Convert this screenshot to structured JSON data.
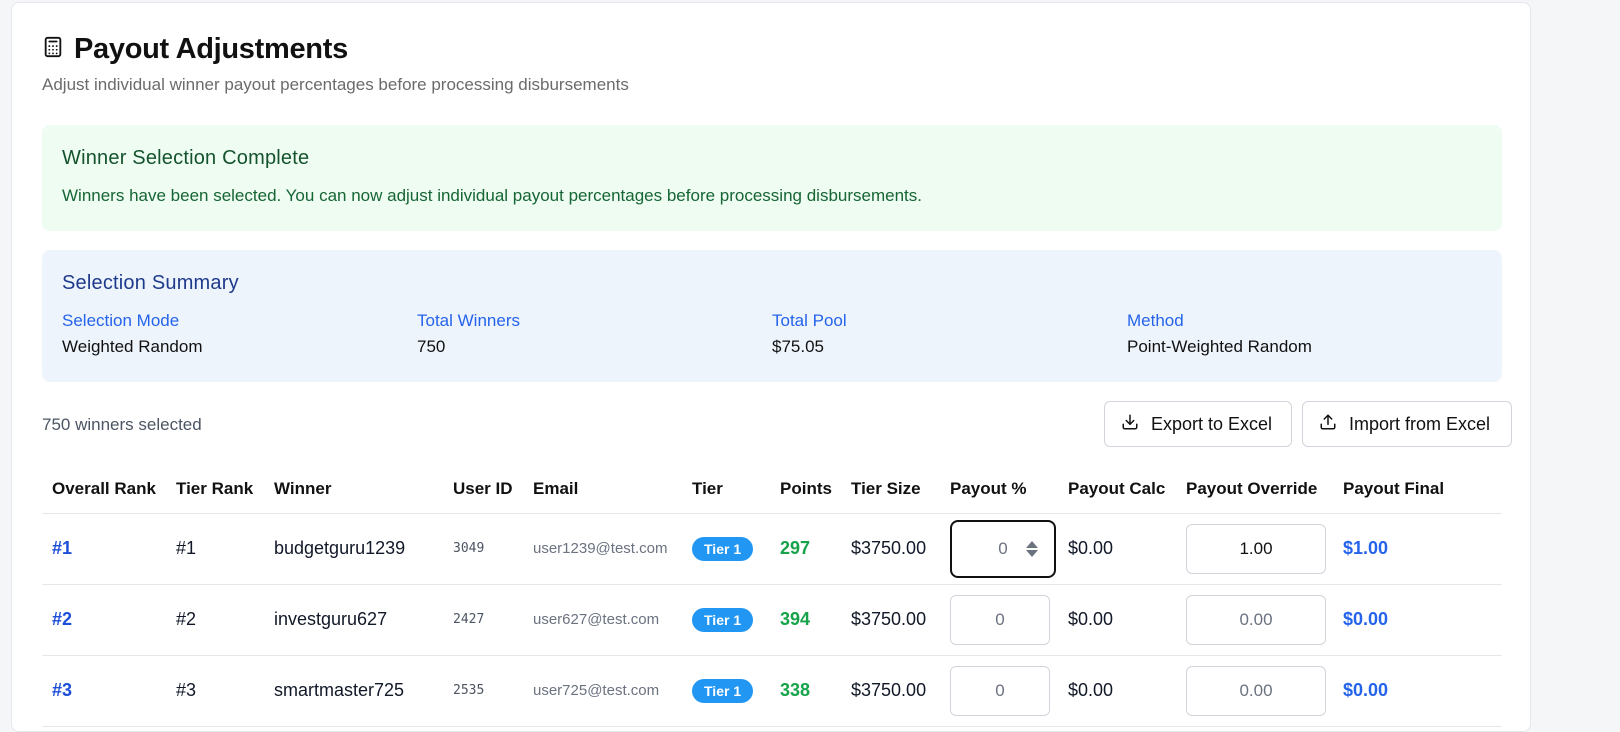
{
  "header": {
    "title": "Payout Adjustments",
    "subtitle": "Adjust individual winner payout percentages before processing disbursements"
  },
  "success": {
    "title": "Winner Selection Complete",
    "text": "Winners have been selected. You can now adjust individual payout percentages before processing disbursements."
  },
  "summary": {
    "title": "Selection Summary",
    "items": [
      {
        "label": "Selection Mode",
        "value": "Weighted Random"
      },
      {
        "label": "Total Winners",
        "value": "750"
      },
      {
        "label": "Total Pool",
        "value": "$75.05"
      },
      {
        "label": "Method",
        "value": "Point-Weighted Random"
      }
    ]
  },
  "toolbar": {
    "count_text": "750 winners selected",
    "export_label": "Export to Excel",
    "import_label": "Import from Excel"
  },
  "table": {
    "columns": [
      "Overall Rank",
      "Tier Rank",
      "Winner",
      "User ID",
      "Email",
      "Tier",
      "Points",
      "Tier Size",
      "Payout %",
      "Payout Calc",
      "Payout Override",
      "Payout Final"
    ],
    "rows": [
      {
        "overall_rank": "#1",
        "tier_rank": "#1",
        "winner": "budgetguru1239",
        "user_id": "3049",
        "email": "user1239@test.com",
        "tier": "Tier 1",
        "points": "297",
        "tier_size": "$3750.00",
        "payout_pct": "0",
        "payout_calc": "$0.00",
        "payout_override": "1.00",
        "payout_final": "$1.00"
      },
      {
        "overall_rank": "#2",
        "tier_rank": "#2",
        "winner": "investguru627",
        "user_id": "2427",
        "email": "user627@test.com",
        "tier": "Tier 1",
        "points": "394",
        "tier_size": "$3750.00",
        "payout_pct": "0",
        "payout_calc": "$0.00",
        "payout_override": "0.00",
        "payout_final": "$0.00"
      },
      {
        "overall_rank": "#3",
        "tier_rank": "#3",
        "winner": "smartmaster725",
        "user_id": "2535",
        "email": "user725@test.com",
        "tier": "Tier 1",
        "points": "338",
        "tier_size": "$3750.00",
        "payout_pct": "0",
        "payout_calc": "$0.00",
        "payout_override": "0.00",
        "payout_final": "$0.00"
      }
    ]
  },
  "colors": {
    "accent_blue": "#2563eb",
    "success_bg": "#eefcf2",
    "summary_bg": "#eef4fc",
    "tier_badge": "#2196f3",
    "points_green": "#16a34a"
  },
  "icons": {
    "title": "calculator-icon",
    "export": "download-icon",
    "import": "upload-icon"
  }
}
